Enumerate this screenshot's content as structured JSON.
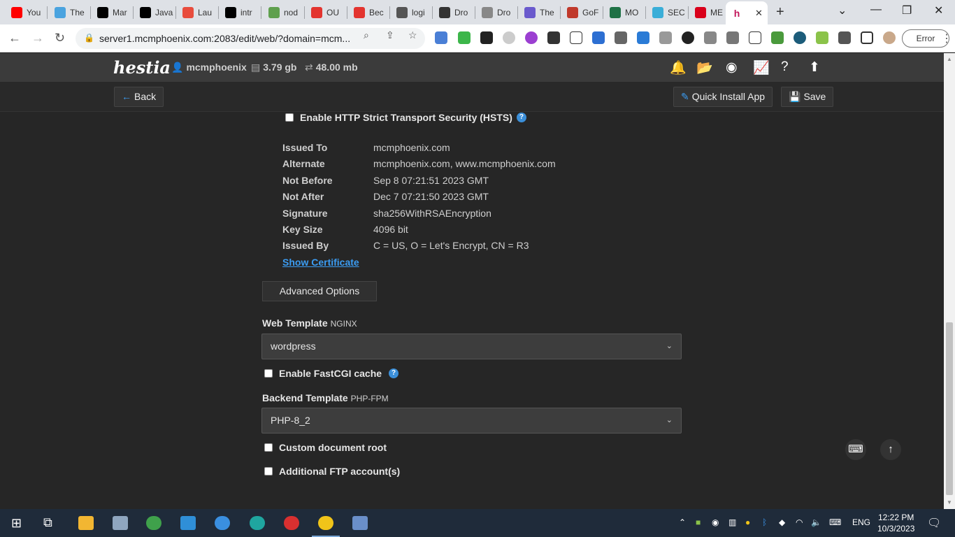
{
  "browser": {
    "tabs": [
      {
        "label": "You",
        "color": "#ff0000"
      },
      {
        "label": "The",
        "color": "#4aa3df"
      },
      {
        "label": "Mar",
        "color": "#000000"
      },
      {
        "label": "Java",
        "color": "#000000"
      },
      {
        "label": "Lau",
        "color": "#e84c3d"
      },
      {
        "label": "intr",
        "color": "#000000"
      },
      {
        "label": "nod",
        "color": "#5fa04e"
      },
      {
        "label": "OU",
        "color": "#e3342f"
      },
      {
        "label": "Bec",
        "color": "#e3342f"
      },
      {
        "label": "logi",
        "color": "#555555"
      },
      {
        "label": "Dro",
        "color": "#333333"
      },
      {
        "label": "Dro",
        "color": "#888888"
      },
      {
        "label": "The",
        "color": "#6a5acd"
      },
      {
        "label": "GoF",
        "color": "#c0392b"
      },
      {
        "label": "MO",
        "color": "#1e7145"
      },
      {
        "label": "SEC",
        "color": "#3aaed8"
      },
      {
        "label": "ME",
        "color": "#d9001b"
      }
    ],
    "active_tab_close": "✕",
    "url": "server1.mcmphoenix.com:2083/edit/web/?domain=mcm...",
    "error_label": "Error"
  },
  "hestia": {
    "logo": "hestia",
    "user": "mcmphoenix",
    "disk": "3.79 gb",
    "bandwidth": "48.00 mb",
    "back_label": "Back",
    "quick_install_label": "Quick Install App",
    "save_label": "Save"
  },
  "form": {
    "hsts_label": "Enable HTTP Strict Transport Security (HSTS)",
    "certificate": [
      {
        "key": "Issued To",
        "value": "mcmphoenix.com"
      },
      {
        "key": "Alternate",
        "value": "mcmphoenix.com, www.mcmphoenix.com"
      },
      {
        "key": "Not Before",
        "value": "Sep 8 07:21:51 2023 GMT"
      },
      {
        "key": "Not After",
        "value": "Dec 7 07:21:50 2023 GMT"
      },
      {
        "key": "Signature",
        "value": "sha256WithRSAEncryption"
      },
      {
        "key": "Key Size",
        "value": "4096 bit"
      },
      {
        "key": "Issued By",
        "value": "C = US, O = Let's Encrypt, CN = R3"
      }
    ],
    "show_certificate": "Show Certificate",
    "advanced_options": "Advanced Options",
    "web_template_label": "Web Template",
    "web_template_sub": "NGINX",
    "web_template_value": "wordpress",
    "fastcgi_label": "Enable FastCGI cache",
    "backend_template_label": "Backend Template",
    "backend_template_sub": "PHP-FPM",
    "backend_template_value": "PHP-8_2",
    "custom_docroot_label": "Custom document root",
    "ftp_label": "Additional FTP account(s)"
  },
  "taskbar": {
    "language": "ENG",
    "time": "12:22 PM",
    "date": "10/3/2023"
  }
}
